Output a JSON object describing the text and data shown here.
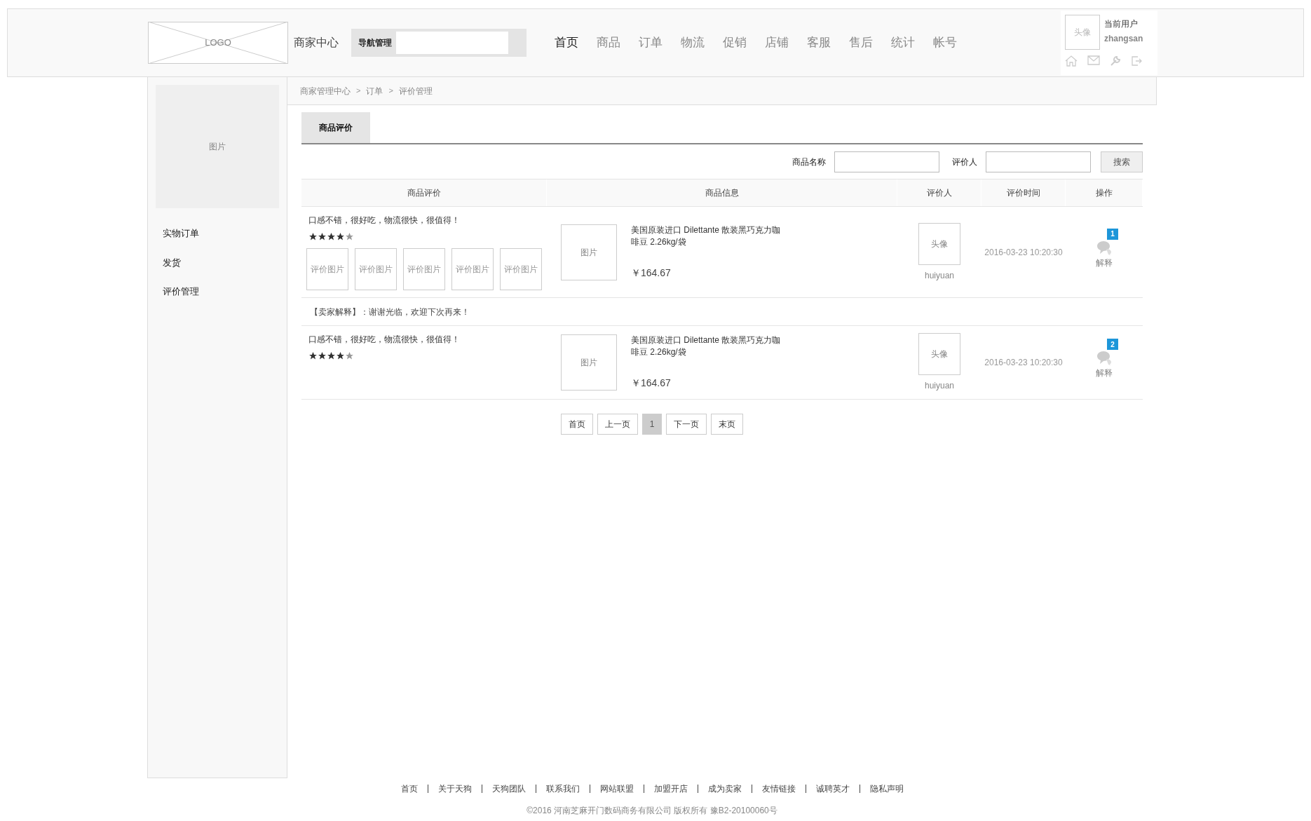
{
  "header": {
    "logo": "LOGO",
    "title": "商家中心",
    "nav_search": {
      "label": "导航管理"
    },
    "nav": [
      {
        "label": "首页",
        "selected": true
      },
      {
        "label": "商品",
        "selected": false
      },
      {
        "label": "订单",
        "selected": false
      },
      {
        "label": "物流",
        "selected": false
      },
      {
        "label": "促销",
        "selected": false
      },
      {
        "label": "店铺",
        "selected": false
      },
      {
        "label": "客服",
        "selected": false
      },
      {
        "label": "售后",
        "selected": false
      },
      {
        "label": "统计",
        "selected": false
      },
      {
        "label": "帐号",
        "selected": false
      }
    ],
    "user": {
      "avatar": "头像",
      "caption": "当前用户",
      "name": "zhangsan"
    }
  },
  "sidebar": {
    "image": "图片",
    "items": [
      {
        "label": "实物订单"
      },
      {
        "label": "发货"
      },
      {
        "label": "评价管理"
      }
    ]
  },
  "breadcrumb": [
    {
      "kind": "link",
      "label": "商家管理中心"
    },
    {
      "kind": "separator",
      "label": ">"
    },
    {
      "kind": "link",
      "label": "订单"
    },
    {
      "kind": "separator",
      "label": ">"
    },
    {
      "kind": "link",
      "label": "评价管理"
    }
  ],
  "tabs": [
    {
      "label": "商品评价",
      "selected": true
    }
  ],
  "filters": {
    "fields": [
      {
        "label": "商品名称"
      },
      {
        "label": "评价人"
      }
    ],
    "button": "搜索"
  },
  "table": {
    "columns": [
      "商品评价",
      "商品信息",
      "评价人",
      "评价时间",
      "操作"
    ],
    "rows": [
      {
        "kind": "review",
        "comment": "口感不错，很好吃，物流很快，很值得！",
        "stars": 4,
        "photos": [
          "评价图片",
          "评价图片",
          "评价图片",
          "评价图片",
          "评价图片"
        ],
        "product_image": "图片",
        "product_name": "美国原装进口 Dilettante 散装黑巧克力咖啡豆 2.26kg/袋",
        "price": "￥164.67",
        "avatar": "头像",
        "reviewer": "huiyuan",
        "time": "2016-03-23 10:20:30",
        "badge": "1",
        "action": "解释"
      },
      {
        "kind": "reply",
        "text": "【卖家解释】：谢谢光临，欢迎下次再来！"
      },
      {
        "kind": "review",
        "comment": "口感不错，很好吃，物流很快，很值得！",
        "stars": 4,
        "photos": [],
        "product_image": "图片",
        "product_name": "美国原装进口 Dilettante 散装黑巧克力咖啡豆 2.26kg/袋",
        "price": "￥164.67",
        "avatar": "头像",
        "reviewer": "huiyuan",
        "time": "2016-03-23 10:20:30",
        "badge": "2",
        "action": "解释"
      }
    ]
  },
  "pagination": [
    {
      "label": "首页",
      "selected": false
    },
    {
      "label": "上一页",
      "selected": false
    },
    {
      "label": "1",
      "selected": true
    },
    {
      "label": "下一页",
      "selected": false
    },
    {
      "label": "末页",
      "selected": false
    }
  ],
  "footer": {
    "links": [
      "首页",
      "关于天狗",
      "天狗团队",
      "联系我们",
      "网站联盟",
      "加盟开店",
      "成为卖家",
      "友情链接",
      "诚聘英才",
      "隐私声明"
    ],
    "copyright": "©2016 河南芝麻开门数码商务有限公司 版权所有 豫B2-20100060号"
  }
}
